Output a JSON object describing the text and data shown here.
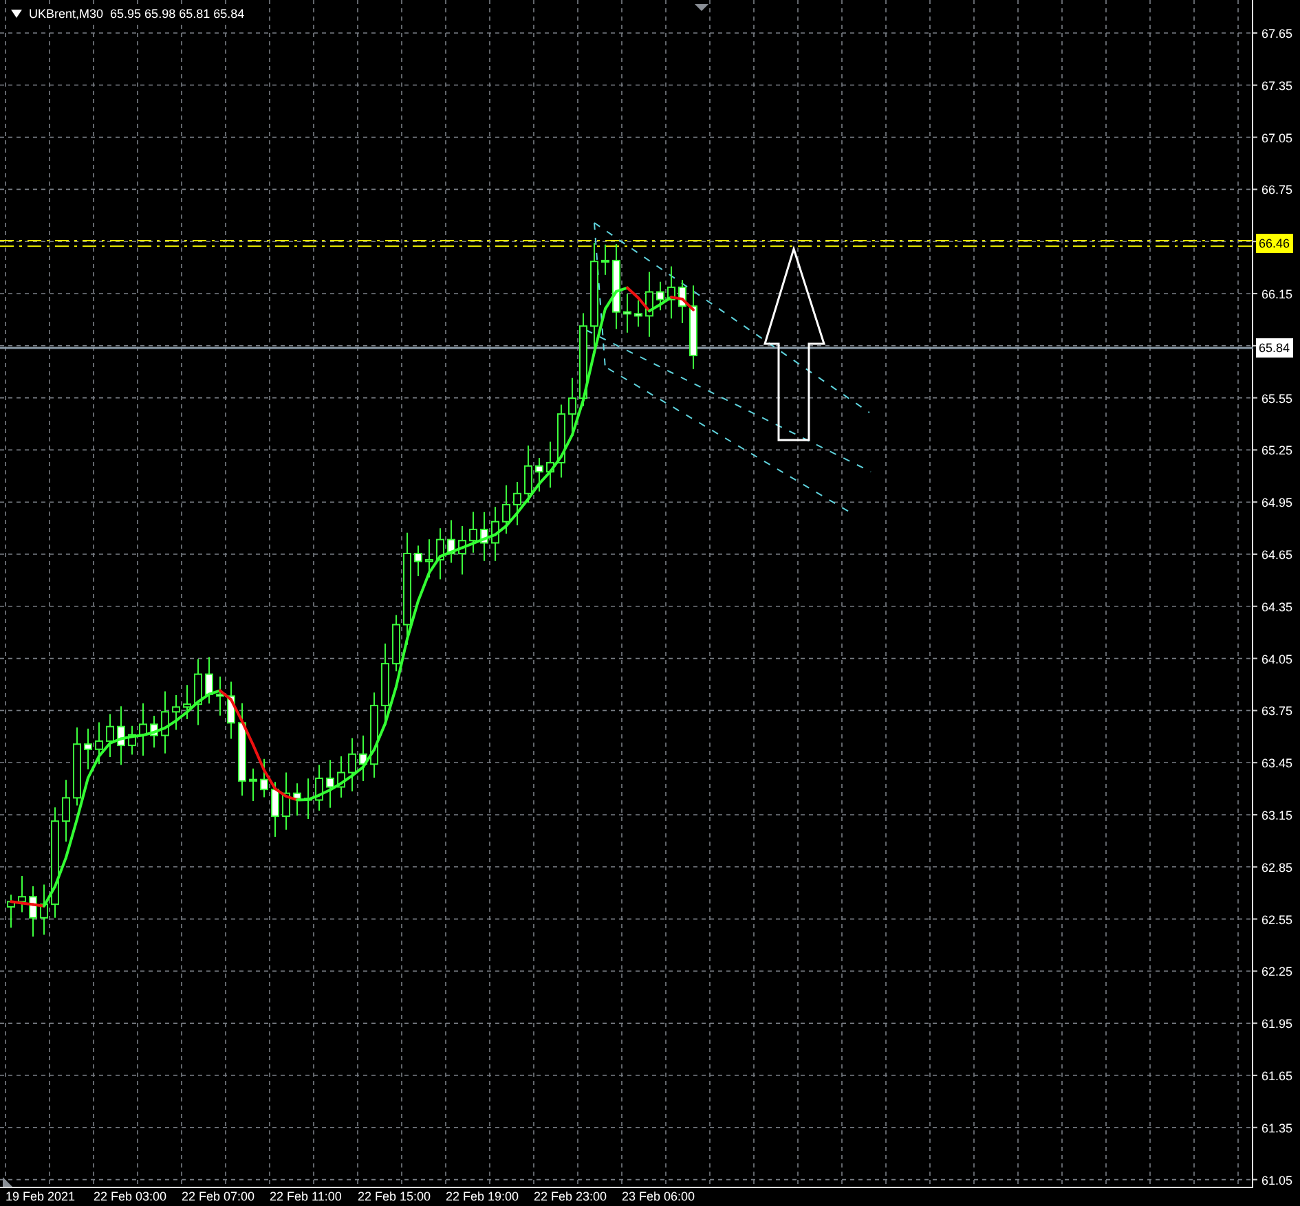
{
  "header": {
    "symbol": "UKBrent,M30",
    "quote": "65.95 65.98 65.81 65.84"
  },
  "price_axis": [
    {
      "kind": "tick",
      "label": "67.65"
    },
    {
      "kind": "tick",
      "label": "67.35"
    },
    {
      "kind": "tick",
      "label": "67.05"
    },
    {
      "kind": "tick",
      "label": "66.75"
    },
    {
      "kind": "level",
      "label": "66.46"
    },
    {
      "kind": "tick",
      "label": "66.15"
    },
    {
      "kind": "bid",
      "label": "65.84"
    },
    {
      "kind": "tick",
      "label": "65.55"
    },
    {
      "kind": "tick",
      "label": "65.25"
    },
    {
      "kind": "tick",
      "label": "64.95"
    },
    {
      "kind": "tick",
      "label": "64.65"
    },
    {
      "kind": "tick",
      "label": "64.35"
    },
    {
      "kind": "tick",
      "label": "64.05"
    },
    {
      "kind": "tick",
      "label": "63.75"
    },
    {
      "kind": "tick",
      "label": "63.45"
    },
    {
      "kind": "tick",
      "label": "63.15"
    },
    {
      "kind": "tick",
      "label": "62.85"
    },
    {
      "kind": "tick",
      "label": "62.55"
    },
    {
      "kind": "tick",
      "label": "62.25"
    },
    {
      "kind": "tick",
      "label": "61.95"
    },
    {
      "kind": "tick",
      "label": "61.65"
    },
    {
      "kind": "tick",
      "label": "61.35"
    },
    {
      "kind": "tick",
      "label": "61.05"
    }
  ],
  "time_axis": [
    "19 Feb 2021",
    "22 Feb 03:00",
    "22 Feb 07:00",
    "22 Feb 11:00",
    "22 Feb 15:00",
    "22 Feb 19:00",
    "22 Feb 23:00",
    "23 Feb 06:00"
  ]
}
